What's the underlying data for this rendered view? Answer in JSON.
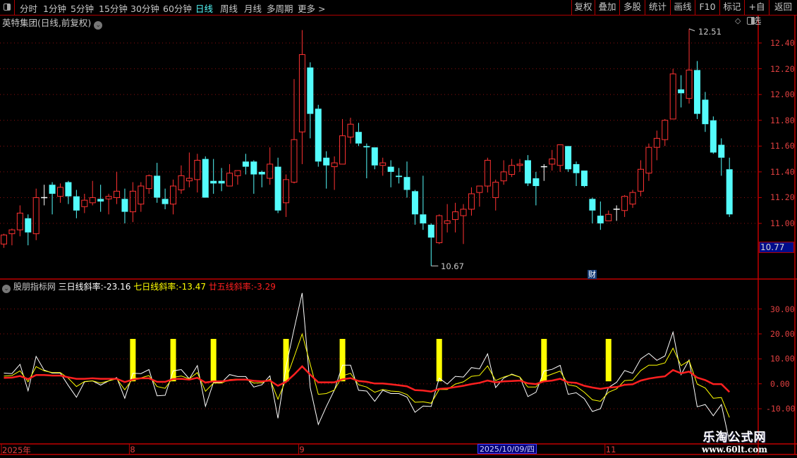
{
  "toolbar": {
    "periods": [
      "分时",
      "1分钟",
      "5分钟",
      "15分钟",
      "30分钟",
      "60分钟",
      "日线",
      "周线",
      "月线",
      "多周期",
      "更多 >"
    ],
    "active_period": "日线",
    "buttons": [
      "复权",
      "叠加",
      "多股",
      "统计",
      "画线",
      "F10",
      "标记",
      "+自选",
      "返回"
    ]
  },
  "main": {
    "title": "英特集团(日线,前复权)",
    "price_ticks": [
      "12.40",
      "12.20",
      "12.00",
      "11.80",
      "11.60",
      "11.40",
      "11.20",
      "11.00"
    ],
    "price_tick_values": [
      12.4,
      12.2,
      12.0,
      11.8,
      11.6,
      11.4,
      11.2,
      11.0
    ],
    "high_label": "12.51",
    "low_label": "10.67",
    "last_price_label": "10.77",
    "finance_marker": "财",
    "colors": {
      "up": "#ff3232",
      "down": "#54fcfc",
      "flat": "#ffffff",
      "grid": "#8c1010",
      "axis": "#c00000"
    },
    "candles": [
      [
        10.84,
        10.92,
        10.81,
        10.91
      ],
      [
        10.92,
        10.96,
        10.83,
        10.95
      ],
      [
        10.95,
        11.14,
        10.9,
        11.08
      ],
      [
        11.04,
        11.07,
        10.83,
        10.93
      ],
      [
        10.92,
        11.27,
        10.87,
        11.2
      ],
      [
        11.2,
        11.3,
        11.14,
        11.2
      ],
      [
        11.3,
        11.32,
        11.07,
        11.23
      ],
      [
        11.21,
        11.31,
        11.16,
        11.28
      ],
      [
        11.32,
        11.33,
        11.15,
        11.21
      ],
      [
        11.21,
        11.26,
        11.04,
        11.1
      ],
      [
        11.13,
        11.23,
        11.08,
        11.18
      ],
      [
        11.16,
        11.33,
        11.14,
        11.2
      ],
      [
        11.19,
        11.3,
        11.09,
        11.17
      ],
      [
        11.19,
        11.23,
        11.07,
        11.21
      ],
      [
        11.2,
        11.4,
        11.15,
        11.25
      ],
      [
        11.19,
        11.27,
        11.0,
        11.09
      ],
      [
        11.09,
        11.32,
        11.01,
        11.25
      ],
      [
        11.15,
        11.32,
        11.09,
        11.29
      ],
      [
        11.27,
        11.38,
        11.23,
        11.37
      ],
      [
        11.37,
        11.47,
        11.16,
        11.2
      ],
      [
        11.19,
        11.27,
        11.11,
        11.15
      ],
      [
        11.15,
        11.34,
        11.07,
        11.29
      ],
      [
        11.26,
        11.45,
        11.23,
        11.37
      ],
      [
        11.33,
        11.55,
        11.28,
        11.35
      ],
      [
        11.34,
        11.54,
        11.24,
        11.49
      ],
      [
        11.5,
        11.52,
        11.2,
        11.2
      ],
      [
        11.33,
        11.5,
        11.23,
        11.31
      ],
      [
        11.33,
        11.43,
        11.25,
        11.31
      ],
      [
        11.29,
        11.46,
        11.29,
        11.39
      ],
      [
        11.37,
        11.41,
        11.3,
        11.41
      ],
      [
        11.48,
        11.54,
        11.38,
        11.44
      ],
      [
        11.48,
        11.49,
        11.23,
        11.38
      ],
      [
        11.4,
        11.41,
        11.28,
        11.38
      ],
      [
        11.35,
        11.59,
        11.3,
        11.46
      ],
      [
        11.44,
        11.51,
        11.08,
        11.1
      ],
      [
        11.16,
        11.38,
        11.05,
        11.34
      ],
      [
        11.32,
        12.12,
        11.31,
        11.65
      ],
      [
        11.71,
        12.5,
        11.46,
        12.31
      ],
      [
        12.21,
        12.25,
        11.66,
        11.85
      ],
      [
        11.89,
        11.92,
        11.44,
        11.48
      ],
      [
        11.51,
        11.56,
        11.27,
        11.45
      ],
      [
        11.44,
        11.52,
        11.26,
        11.47
      ],
      [
        11.46,
        11.81,
        11.46,
        11.68
      ],
      [
        11.67,
        11.82,
        11.62,
        11.77
      ],
      [
        11.71,
        11.78,
        11.6,
        11.62
      ],
      [
        11.6,
        11.62,
        11.35,
        11.59
      ],
      [
        11.59,
        11.59,
        11.42,
        11.45
      ],
      [
        11.45,
        11.51,
        11.37,
        11.47
      ],
      [
        11.44,
        11.49,
        11.28,
        11.4
      ],
      [
        11.37,
        11.43,
        11.31,
        11.36
      ],
      [
        11.36,
        11.48,
        11.2,
        11.26
      ],
      [
        11.25,
        11.26,
        10.99,
        11.07
      ],
      [
        11.07,
        11.37,
        10.95,
        11.0
      ],
      [
        10.99,
        11.0,
        10.67,
        10.89
      ],
      [
        10.85,
        11.07,
        10.84,
        11.06
      ],
      [
        11.0,
        11.15,
        10.93,
        11.02
      ],
      [
        11.03,
        11.16,
        10.93,
        11.09
      ],
      [
        11.06,
        11.15,
        10.84,
        11.11
      ],
      [
        11.11,
        11.28,
        11.06,
        11.23
      ],
      [
        11.24,
        11.29,
        11.13,
        11.29
      ],
      [
        11.29,
        11.51,
        11.24,
        11.49
      ],
      [
        11.2,
        11.34,
        11.1,
        11.32
      ],
      [
        11.33,
        11.49,
        11.3,
        11.4
      ],
      [
        11.38,
        11.5,
        11.36,
        11.45
      ],
      [
        11.45,
        11.5,
        11.4,
        11.46
      ],
      [
        11.49,
        11.53,
        11.29,
        11.31
      ],
      [
        11.35,
        11.4,
        11.14,
        11.29
      ],
      [
        11.44,
        11.46,
        11.33,
        11.44
      ],
      [
        11.46,
        11.57,
        11.41,
        11.5
      ],
      [
        11.45,
        11.61,
        11.4,
        11.61
      ],
      [
        11.6,
        11.6,
        11.4,
        11.42
      ],
      [
        11.46,
        11.48,
        11.29,
        11.39
      ],
      [
        11.41,
        11.41,
        11.28,
        11.29
      ],
      [
        11.19,
        11.2,
        11.0,
        11.1
      ],
      [
        11.06,
        11.17,
        10.95,
        11.0
      ],
      [
        11.02,
        11.1,
        11.02,
        11.07
      ],
      [
        11.11,
        11.14,
        11.02,
        11.11
      ],
      [
        11.1,
        11.22,
        11.05,
        11.21
      ],
      [
        11.15,
        11.26,
        11.12,
        11.24
      ],
      [
        11.25,
        11.49,
        11.21,
        11.42
      ],
      [
        11.39,
        11.62,
        11.33,
        11.59
      ],
      [
        11.59,
        11.72,
        11.49,
        11.66
      ],
      [
        11.65,
        11.81,
        11.6,
        11.8
      ],
      [
        11.81,
        12.2,
        11.81,
        12.16
      ],
      [
        12.04,
        12.15,
        11.9,
        12.01
      ],
      [
        11.97,
        12.51,
        11.93,
        12.19
      ],
      [
        12.19,
        12.26,
        11.81,
        11.85
      ],
      [
        11.96,
        12.02,
        11.71,
        11.77
      ],
      [
        11.8,
        11.83,
        11.54,
        11.55
      ],
      [
        11.61,
        11.66,
        11.37,
        11.51
      ],
      [
        11.42,
        11.51,
        11.05,
        11.07
      ]
    ]
  },
  "indicator": {
    "name": "股朋指标网",
    "series": [
      {
        "name": "三日线斜率",
        "label": "三日线斜率:",
        "value_label": "-23.16",
        "color": "#ffffff",
        "values": [
          4.3,
          4.1,
          7.8,
          -2.8,
          11.0,
          5.5,
          4.3,
          4.3,
          -0.7,
          -5.4,
          0.8,
          1.2,
          -0.5,
          1.2,
          2.5,
          -5.8,
          4.2,
          4.1,
          5.7,
          -4.8,
          -4.6,
          5.2,
          5.7,
          2.0,
          7.3,
          -9.0,
          0.5,
          0.5,
          3.7,
          2.9,
          2.9,
          -1.3,
          -0.4,
          3.2,
          -13.8,
          7.0,
          22.0,
          36.4,
          -1.5,
          -16.3,
          -9.1,
          -2.5,
          7.5,
          7.5,
          -2.6,
          -2.9,
          -7.0,
          -2.6,
          -3.9,
          -3.9,
          -5.3,
          -11.4,
          -8.9,
          -9.1,
          2.3,
          -0.1,
          3.0,
          2.7,
          6.5,
          6.0,
          12.0,
          -1.5,
          2.3,
          3.9,
          2.7,
          -5.1,
          -3.4,
          5.1,
          5.8,
          7.4,
          -4.2,
          -3.6,
          -6.0,
          -11.1,
          -10.0,
          -1.5,
          0.6,
          5.3,
          4.2,
          10.0,
          12.2,
          9.4,
          11.2,
          20.7,
          3.7,
          9.6,
          -9.2,
          -8.3,
          -12.8,
          -8.3,
          -23.16
        ]
      },
      {
        "name": "七日线斜率",
        "label": "七日线斜率:",
        "value_label": "-13.47",
        "color": "#ffff00",
        "values": [
          3.1,
          3.3,
          5.2,
          0.8,
          6.9,
          5.2,
          4.5,
          4.5,
          2.2,
          -1.1,
          0.9,
          1.2,
          0.3,
          1.2,
          2.0,
          -2.4,
          2.2,
          2.4,
          3.3,
          -1.1,
          -1.8,
          2.6,
          3.1,
          2.0,
          4.5,
          -3.0,
          0.3,
          0.3,
          1.7,
          1.9,
          1.9,
          0.3,
          0.4,
          1.8,
          -6.2,
          1.8,
          10.8,
          20.0,
          7.9,
          -4.2,
          -3.9,
          -2.5,
          3.2,
          4.2,
          -0.4,
          -1.3,
          -3.4,
          -2.3,
          -2.9,
          -3.1,
          -4.3,
          -7.4,
          -7.2,
          -7.8,
          -2.3,
          -2.3,
          -0.1,
          0.8,
          3.0,
          3.4,
          7.2,
          1.3,
          2.7,
          3.7,
          2.7,
          -1.3,
          -1.3,
          2.7,
          3.9,
          5.1,
          -0.4,
          -1.0,
          -3.4,
          -6.4,
          -7.0,
          -3.4,
          -2.0,
          1.3,
          1.5,
          5.3,
          7.5,
          7.5,
          8.4,
          14.3,
          7.3,
          9.3,
          -0.1,
          -1.7,
          -5.8,
          -5.5,
          -13.47
        ]
      },
      {
        "name": "廿五线斜率",
        "label": "廿五线斜率:",
        "value_label": "-3.29",
        "color": "#ff2020",
        "values": [
          2.4,
          2.5,
          3.1,
          1.9,
          3.5,
          3.5,
          3.3,
          3.3,
          2.6,
          2.0,
          2.0,
          2.2,
          2.0,
          2.0,
          2.0,
          0.7,
          1.7,
          2.2,
          2.2,
          0.8,
          0.8,
          1.9,
          2.0,
          1.7,
          2.4,
          0.5,
          1.0,
          1.0,
          1.4,
          1.7,
          1.7,
          1.2,
          1.0,
          1.3,
          -0.8,
          0.8,
          3.7,
          7.0,
          3.7,
          0.6,
          0.6,
          0.6,
          1.8,
          2.3,
          1.1,
          0.8,
          0.1,
          0.1,
          -0.2,
          -0.6,
          -1.0,
          -2.5,
          -2.7,
          -3.1,
          -2.0,
          -1.8,
          -1.3,
          -0.8,
          -0.1,
          0.4,
          1.3,
          0.6,
          1.0,
          1.1,
          1.3,
          0.2,
          -0.1,
          1.0,
          1.3,
          2.0,
          0.6,
          0.4,
          -0.8,
          -1.5,
          -2.0,
          -1.5,
          -1.3,
          -0.4,
          -0.2,
          1.3,
          2.1,
          2.6,
          3.0,
          5.5,
          4.2,
          4.9,
          2.5,
          1.5,
          -0.1,
          -0.1,
          -3.29
        ]
      }
    ],
    "signal_candles": [
      17,
      22,
      27,
      36,
      43,
      55,
      68,
      76
    ],
    "signal_range": [
      1,
      18
    ],
    "signal_color": "#ffff00",
    "ticks": [
      "30.00",
      "20.00",
      "10.00",
      "0.00",
      "-10.00"
    ],
    "tick_values": [
      30,
      20,
      10,
      0,
      -10
    ]
  },
  "xaxis": {
    "labels": [
      {
        "text": "2025年",
        "candle": 1
      },
      {
        "text": "8",
        "candle": 17
      },
      {
        "text": "9",
        "candle": 38
      },
      {
        "text": "11",
        "candle": 76
      }
    ],
    "cursor_date": "2025/10/09/四"
  },
  "watermark": {
    "line1": "乐淘公式网",
    "line2": "www.60lt.com"
  }
}
